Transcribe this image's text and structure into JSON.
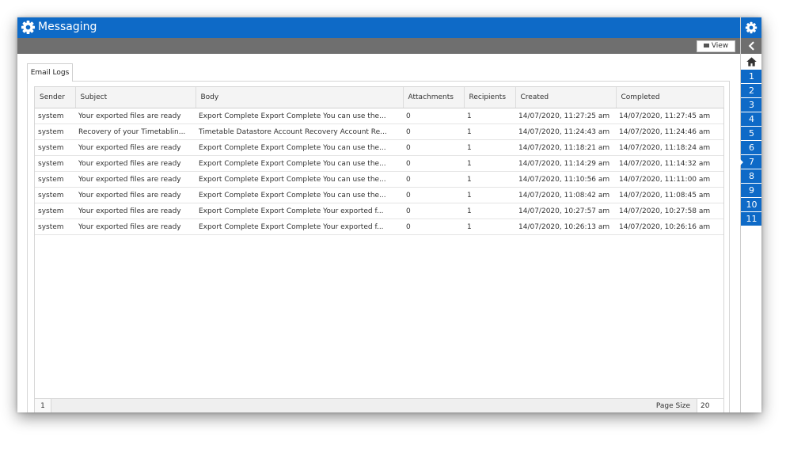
{
  "app": {
    "title": "Messaging"
  },
  "toolbar": {
    "view_label": "View"
  },
  "tabs": [
    {
      "label": "Email Logs"
    }
  ],
  "table": {
    "columns": [
      "Sender",
      "Subject",
      "Body",
      "Attachments",
      "Recipients",
      "Created",
      "Completed"
    ],
    "rows": [
      [
        "system",
        "Your exported files are ready",
        "Export Complete Export Complete You can use the...",
        "0",
        "1",
        "14/07/2020, 11:27:25 am",
        "14/07/2020, 11:27:45 am"
      ],
      [
        "system",
        "Recovery of your Timetablin...",
        "Timetable Datastore Account Recovery Account Re...",
        "0",
        "1",
        "14/07/2020, 11:24:43 am",
        "14/07/2020, 11:24:46 am"
      ],
      [
        "system",
        "Your exported files are ready",
        "Export Complete Export Complete You can use the...",
        "0",
        "1",
        "14/07/2020, 11:18:21 am",
        "14/07/2020, 11:18:24 am"
      ],
      [
        "system",
        "Your exported files are ready",
        "Export Complete Export Complete You can use the...",
        "0",
        "1",
        "14/07/2020, 11:14:29 am",
        "14/07/2020, 11:14:32 am"
      ],
      [
        "system",
        "Your exported files are ready",
        "Export Complete Export Complete You can use the...",
        "0",
        "1",
        "14/07/2020, 11:10:56 am",
        "14/07/2020, 11:11:00 am"
      ],
      [
        "system",
        "Your exported files are ready",
        "Export Complete Export Complete You can use the...",
        "0",
        "1",
        "14/07/2020, 11:08:42 am",
        "14/07/2020, 11:08:45 am"
      ],
      [
        "system",
        "Your exported files are ready",
        "Export Complete Export Complete Your exported f...",
        "0",
        "1",
        "14/07/2020, 10:27:57 am",
        "14/07/2020, 10:27:58 am"
      ],
      [
        "system",
        "Your exported files are ready",
        "Export Complete Export Complete Your exported f...",
        "0",
        "1",
        "14/07/2020, 10:26:13 am",
        "14/07/2020, 10:26:16 am"
      ]
    ]
  },
  "pager": {
    "current_page": "1",
    "page_size_label": "Page Size",
    "page_size_value": "20"
  },
  "rightbar": {
    "numbers": [
      "1",
      "2",
      "3",
      "4",
      "5",
      "6",
      "7",
      "8",
      "9",
      "10",
      "11"
    ],
    "active": "7"
  },
  "icons": {
    "titlebar": "gear-icon",
    "settings": "gear-icon",
    "back": "chevron-left-icon",
    "home": "home-icon",
    "view": "view-icon"
  },
  "colors": {
    "accent": "#0e6ac7",
    "toolbar": "#6f6f6f"
  }
}
